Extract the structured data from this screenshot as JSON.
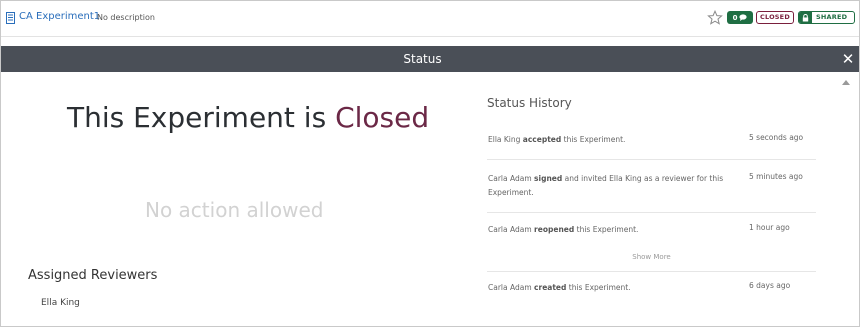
{
  "experiment": {
    "title": "CA Experiment1",
    "description": "No description",
    "comment_count": "0",
    "status_badge": "CLOSED",
    "shared_badge": "SHARED"
  },
  "status_panel": {
    "title": "Status",
    "headline_prefix": "This Experiment is ",
    "headline_status": "Closed",
    "no_action": "No action allowed",
    "assigned_reviewers_title": "Assigned Reviewers",
    "reviewers": [
      "Ella King"
    ]
  },
  "history": {
    "title": "Status History",
    "show_more": "Show More",
    "entries": [
      {
        "actor": "Ella King",
        "verb": "accepted",
        "rest": " this Experiment.",
        "time": "5 seconds ago"
      },
      {
        "actor": "Carla Adam",
        "verb": "signed",
        "rest": " and invited Ella King as a reviewer for this Experiment.",
        "time": "5 minutes ago"
      },
      {
        "actor": "Carla Adam",
        "verb": "reopened",
        "rest": " this Experiment.",
        "time": "1 hour ago"
      },
      {
        "actor": "Carla Adam",
        "verb": "created",
        "rest": " this Experiment.",
        "time": "6 days ago"
      }
    ]
  },
  "colors": {
    "link": "#2a6ebb",
    "closed": "#6b2846",
    "shared_green": "#1f6e43",
    "header_bg": "#4a4f57"
  },
  "icons": [
    "document-icon",
    "star-icon",
    "comment-icon",
    "lock-icon",
    "close-icon",
    "scroll-up-icon"
  ]
}
